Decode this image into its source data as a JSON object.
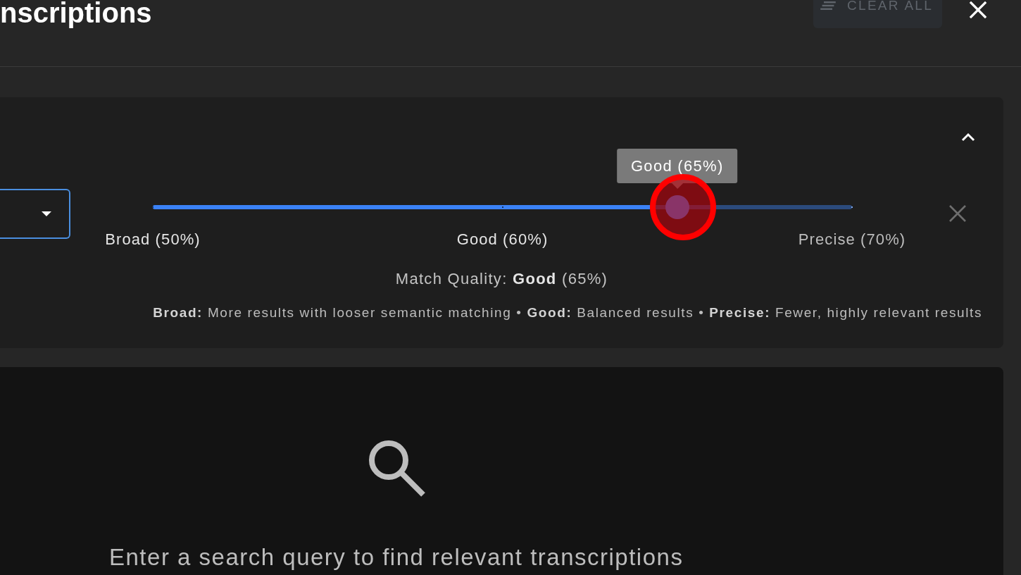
{
  "header": {
    "title": "nscriptions",
    "clear_all_button": {
      "label": "CLEAR ALL",
      "disabled": true
    }
  },
  "filter_panel": {
    "expanded": true,
    "dropdown": {
      "focused": true
    },
    "slider": {
      "level": 0.75,
      "tooltip": "Good (65%)",
      "highlighted": true,
      "marks": [
        {
          "label": "Broad (50%)"
        },
        {
          "label": "Good (60%)"
        },
        {
          "label": "Precise (70%)"
        }
      ]
    },
    "match_quality": "Match Quality: **Good** (65%)",
    "legend": "**Broad:** More results with looser semantic matching • **Good:** Balanced results • **Precise:** Fewer, highly relevant results"
  },
  "results_panel": {
    "empty_message": "Enter a search query to find relevant transcriptions"
  }
}
